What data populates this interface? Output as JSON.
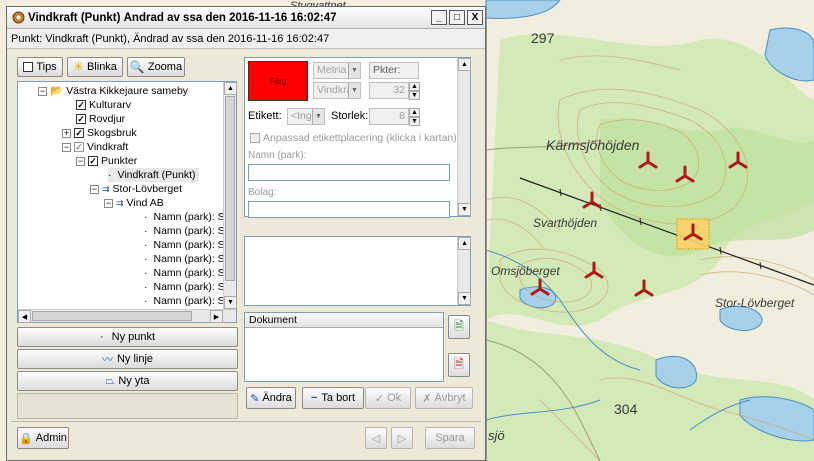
{
  "map": {
    "labels": [
      "Stugvattnet",
      "297",
      "Kärmsjöhöjden",
      "Svarthöjden",
      "Omsjöberget",
      "Stor-Lövberget",
      "304",
      "sjö"
    ]
  },
  "window": {
    "title": "Vindkraft (Punkt) Ändrad av ssa den 2016-11-16 16:02:47",
    "subtitle": "Punkt: Vindkraft (Punkt), Ändrad av ssa den 2016-11-16 16:02:47",
    "controls": [
      "_",
      "□",
      "X"
    ]
  },
  "toolbar": {
    "tips": "Tips",
    "blinka": "Blinka",
    "zooma": "Zooma"
  },
  "tree": {
    "rows": [
      "Västra Kikkejaure sameby",
      "Kulturarv",
      "Rovdjur",
      "Skogsbruk",
      "Vindkraft",
      "Punkter",
      "Vindkraft (Punkt)",
      "Stor-Lövberget",
      "Vind AB",
      "Namn (park): S",
      "Namn (park): S",
      "Namn (park): S",
      "Namn (park): S",
      "Namn (park): S",
      "Namn (park): S",
      "Namn (park): S"
    ]
  },
  "actions": {
    "ny_punkt": "Ny punkt",
    "ny_linje": "Ny linje",
    "ny_yta": "Ny yta"
  },
  "admin": "Admin",
  "props": {
    "farg": "Färg",
    "farg_color": "#ff0000",
    "metria": "Metria k",
    "vindkra": "Vindkra",
    "pkter_label": "Pkter:",
    "pkter_value": "32",
    "etikett_label": "Etikett:",
    "etikett_value": "<Ing",
    "storlek_label": "Storlek:",
    "storlek_value": "8",
    "anpassad": "Anpassad etikettplacering (klicka i kartan)",
    "namn_label": "Namn (park):",
    "bolag_label": "Bolag:"
  },
  "dokument": {
    "header": "Dokument"
  },
  "buttons": {
    "andra": "Ändra",
    "ta_bort": "Ta bort",
    "ok": "Ok",
    "avbryt": "Avbryt",
    "spara": "Spara"
  }
}
